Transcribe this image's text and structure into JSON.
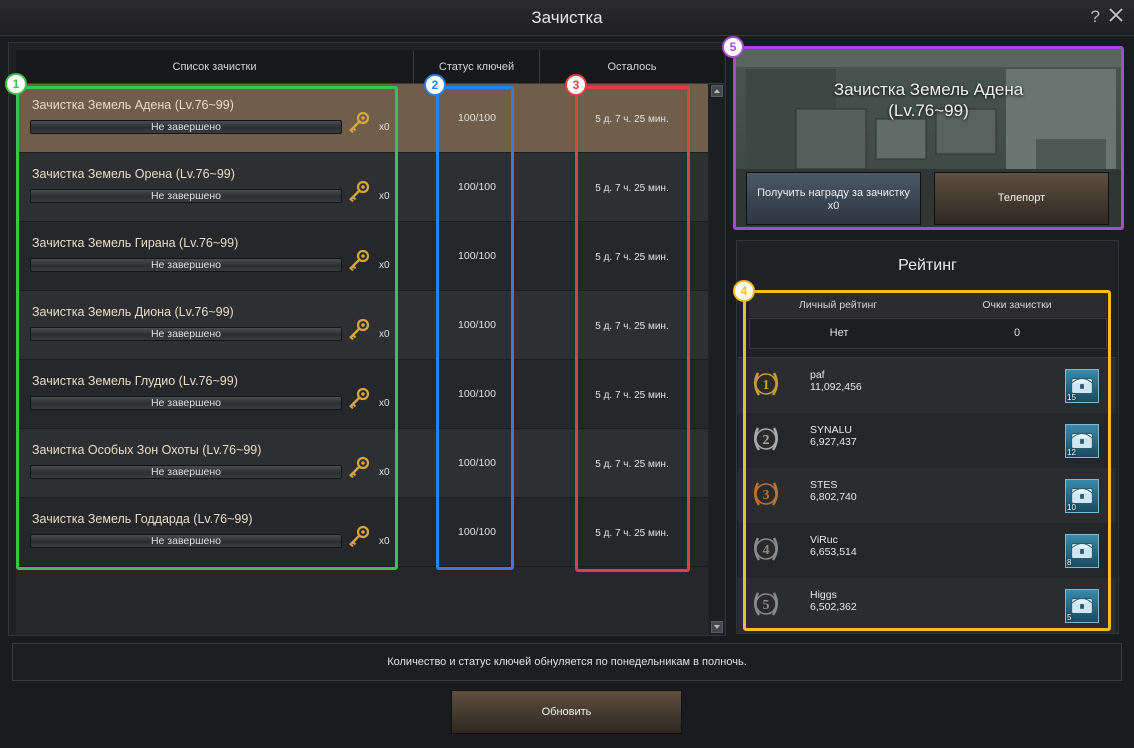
{
  "window": {
    "title": "Зачистка",
    "help_label": "?"
  },
  "table": {
    "headers": {
      "list": "Список зачистки",
      "keys": "Статус ключей",
      "remaining": "Осталось"
    },
    "rows": [
      {
        "name": "Зачистка Земель Адена (Lv.76~99)",
        "progress": "Не завершено",
        "key_count": "x0",
        "keys": "100/100",
        "time": "5 д. 7 ч. 25 мин."
      },
      {
        "name": "Зачистка Земель Орена (Lv.76~99)",
        "progress": "Не завершено",
        "key_count": "x0",
        "keys": "100/100",
        "time": "5 д. 7 ч. 25 мин."
      },
      {
        "name": "Зачистка Земель Гирана (Lv.76~99)",
        "progress": "Не завершено",
        "key_count": "x0",
        "keys": "100/100",
        "time": "5 д. 7 ч. 25 мин."
      },
      {
        "name": "Зачистка Земель Диона (Lv.76~99)",
        "progress": "Не завершено",
        "key_count": "x0",
        "keys": "100/100",
        "time": "5 д. 7 ч. 25 мин."
      },
      {
        "name": "Зачистка Земель Глудио (Lv.76~99)",
        "progress": "Не завершено",
        "key_count": "x0",
        "keys": "100/100",
        "time": "5 д. 7 ч. 25 мин."
      },
      {
        "name": "Зачистка Особых Зон Охоты (Lv.76~99)",
        "progress": "Не завершено",
        "key_count": "x0",
        "keys": "100/100",
        "time": "5 д. 7 ч. 25 мин."
      },
      {
        "name": "Зачистка Земель Годдарда (Lv.76~99)",
        "progress": "Не завершено",
        "key_count": "x0",
        "keys": "100/100",
        "time": "5 д. 7 ч. 25 мин."
      }
    ]
  },
  "badges": [
    "1",
    "2",
    "3",
    "4",
    "5"
  ],
  "banner": {
    "title": "Зачистка Земель Адена\n(Lv.76~99)",
    "reward_button": "Получить награду за зачистку\nx0",
    "teleport_button": "Телепорт"
  },
  "ranking": {
    "title": "Рейтинг",
    "col_personal": "Личный рейтинг",
    "col_points": "Очки зачистки",
    "my_rank": "Нет",
    "my_points": "0",
    "entries": [
      {
        "place": "1",
        "name": "paf",
        "score": "11,092,456",
        "chest_count": "15"
      },
      {
        "place": "2",
        "name": "SYNALU",
        "score": "6,927,437",
        "chest_count": "12"
      },
      {
        "place": "3",
        "name": "STES",
        "score": "6,802,740",
        "chest_count": "10"
      },
      {
        "place": "4",
        "name": "ViRuc",
        "score": "6,653,514",
        "chest_count": "8"
      },
      {
        "place": "5",
        "name": "Higgs",
        "score": "6,502,362",
        "chest_count": "5"
      }
    ]
  },
  "footer": {
    "notice": "Количество и статус ключей обнуляется по понедельникам в полночь.",
    "refresh_button": "Обновить"
  },
  "colors": {
    "highlight_1": "#3ec34a",
    "highlight_2": "#2a7fe8",
    "highlight_3": "#e04040",
    "highlight_4": "#f0c020",
    "highlight_5": "#a34ad6",
    "gold": "#c89a3a",
    "silver": "#a9a9a9",
    "bronze": "#b87333"
  },
  "icons": {
    "row_key": "golden-key-icon",
    "reward_chest": "treasure-chest-icon",
    "medal": "laurel-medal-icon",
    "close": "close-icon",
    "help": "help-icon"
  }
}
